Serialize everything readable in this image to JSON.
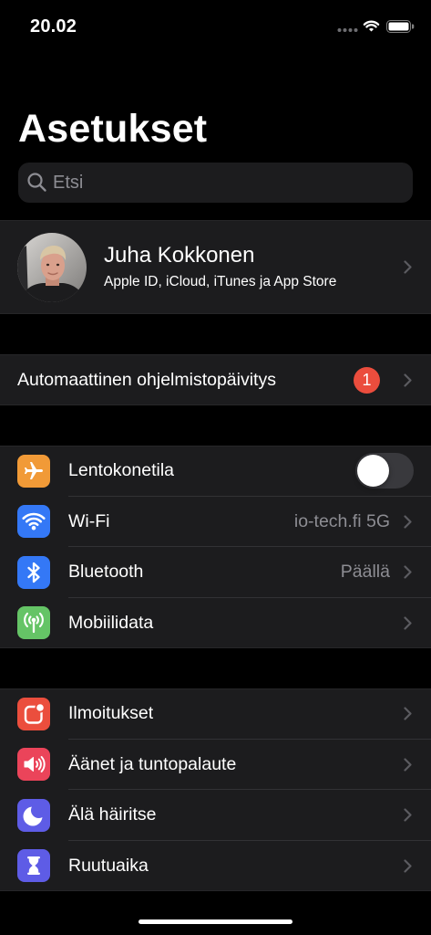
{
  "status_bar": {
    "time": "20.02",
    "icons": [
      "cellular-dots-icon",
      "wifi-icon",
      "battery-icon"
    ]
  },
  "header": {
    "title": "Asetukset"
  },
  "search": {
    "placeholder": "Etsi",
    "icon": "search-icon"
  },
  "profile": {
    "name": "Juha Kokkonen",
    "subtitle": "Apple ID, iCloud, iTunes ja App Store"
  },
  "software_update": {
    "label": "Automaattinen ohjelmistopäivitys",
    "badge": "1",
    "badge_color": "#eb4d3d"
  },
  "connectivity": [
    {
      "label": "Lentokonetila",
      "icon": "airplane-icon",
      "color": "#f19a37",
      "toggle_on": false
    },
    {
      "label": "Wi-Fi",
      "icon": "wifi-icon",
      "color": "#3478f6",
      "value": "io-tech.fi 5G"
    },
    {
      "label": "Bluetooth",
      "icon": "bluetooth-icon",
      "color": "#3478f6",
      "value": "Päällä"
    },
    {
      "label": "Mobiilidata",
      "icon": "cellular-antenna-icon",
      "color": "#65c466"
    }
  ],
  "alerts": [
    {
      "label": "Ilmoitukset",
      "icon": "notifications-icon",
      "color": "#eb4e3d"
    },
    {
      "label": "Äänet ja tuntopalaute",
      "icon": "sounds-icon",
      "color": "#eb445a"
    },
    {
      "label": "Älä häiritse",
      "icon": "moon-icon",
      "color": "#5e5ce6"
    },
    {
      "label": "Ruutuaika",
      "icon": "hourglass-icon",
      "color": "#5e5ce6"
    }
  ],
  "theme": {
    "background": "#000000",
    "cell": "#1c1c1e",
    "separator": "#323235",
    "secondary_text": "#8d8d93",
    "chevron": "#5b5b60"
  }
}
